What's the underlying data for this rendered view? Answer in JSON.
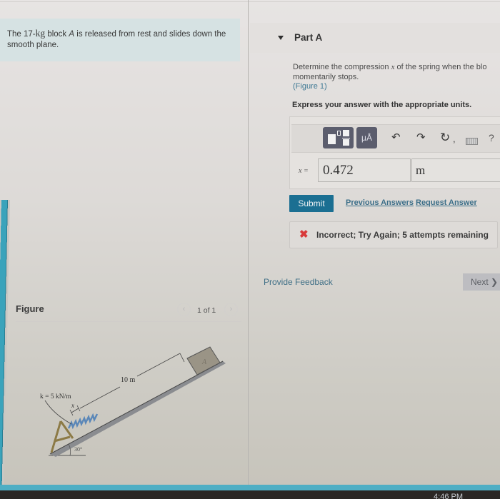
{
  "problem": {
    "text_before": "The 17-",
    "mass_unit": "kg",
    "text_middle": " block ",
    "block_var": "A",
    "text_after": " is released from rest and slides down the smooth plane."
  },
  "part": {
    "title": "Part A",
    "question_line1_before": "Determine the compression ",
    "question_var": "x",
    "question_line1_after": " of the spring when the blo",
    "question_line2": "momentarily stops.",
    "figure_link": "(Figure 1)",
    "instruction": "Express your answer with the appropriate units."
  },
  "toolbar": {
    "icons": [
      "templates-icon",
      "units-mu-angstrom-icon",
      "undo-icon",
      "redo-icon",
      "reset-icon",
      "keyboard-icon",
      "help-icon"
    ],
    "units_label": "μÅ",
    "undo_glyph": "↶",
    "redo_glyph": "↷",
    "reset_glyph": "↻",
    "reset_suffix": ",",
    "help_label": "?"
  },
  "answer": {
    "label": "x =",
    "value": "0.472",
    "unit": "m"
  },
  "actions": {
    "submit": "Submit",
    "previous_answers": "Previous Answers",
    "request_answer": "Request Answer"
  },
  "feedback": {
    "status": "incorrect",
    "status_color": "#d83a3a",
    "message": "Incorrect; Try Again; 5 attempts remaining",
    "attempts_remaining": 5
  },
  "footer": {
    "provide_feedback": "Provide Feedback",
    "next": "Next ❯"
  },
  "figure": {
    "title": "Figure",
    "pager": "1 of 1",
    "prev": "‹",
    "next": "›",
    "labels": {
      "distance": "10 m",
      "spring_constant": "k = 5 kN/m",
      "compression": "x",
      "angle": "30°",
      "block": "A"
    }
  },
  "taskbar": {
    "clock": "4:46 PM"
  },
  "colors": {
    "accent": "#1b6f92",
    "link": "#3c6f89",
    "frame": "#3aa3bb",
    "problem_bg": "#d6e2e3"
  }
}
